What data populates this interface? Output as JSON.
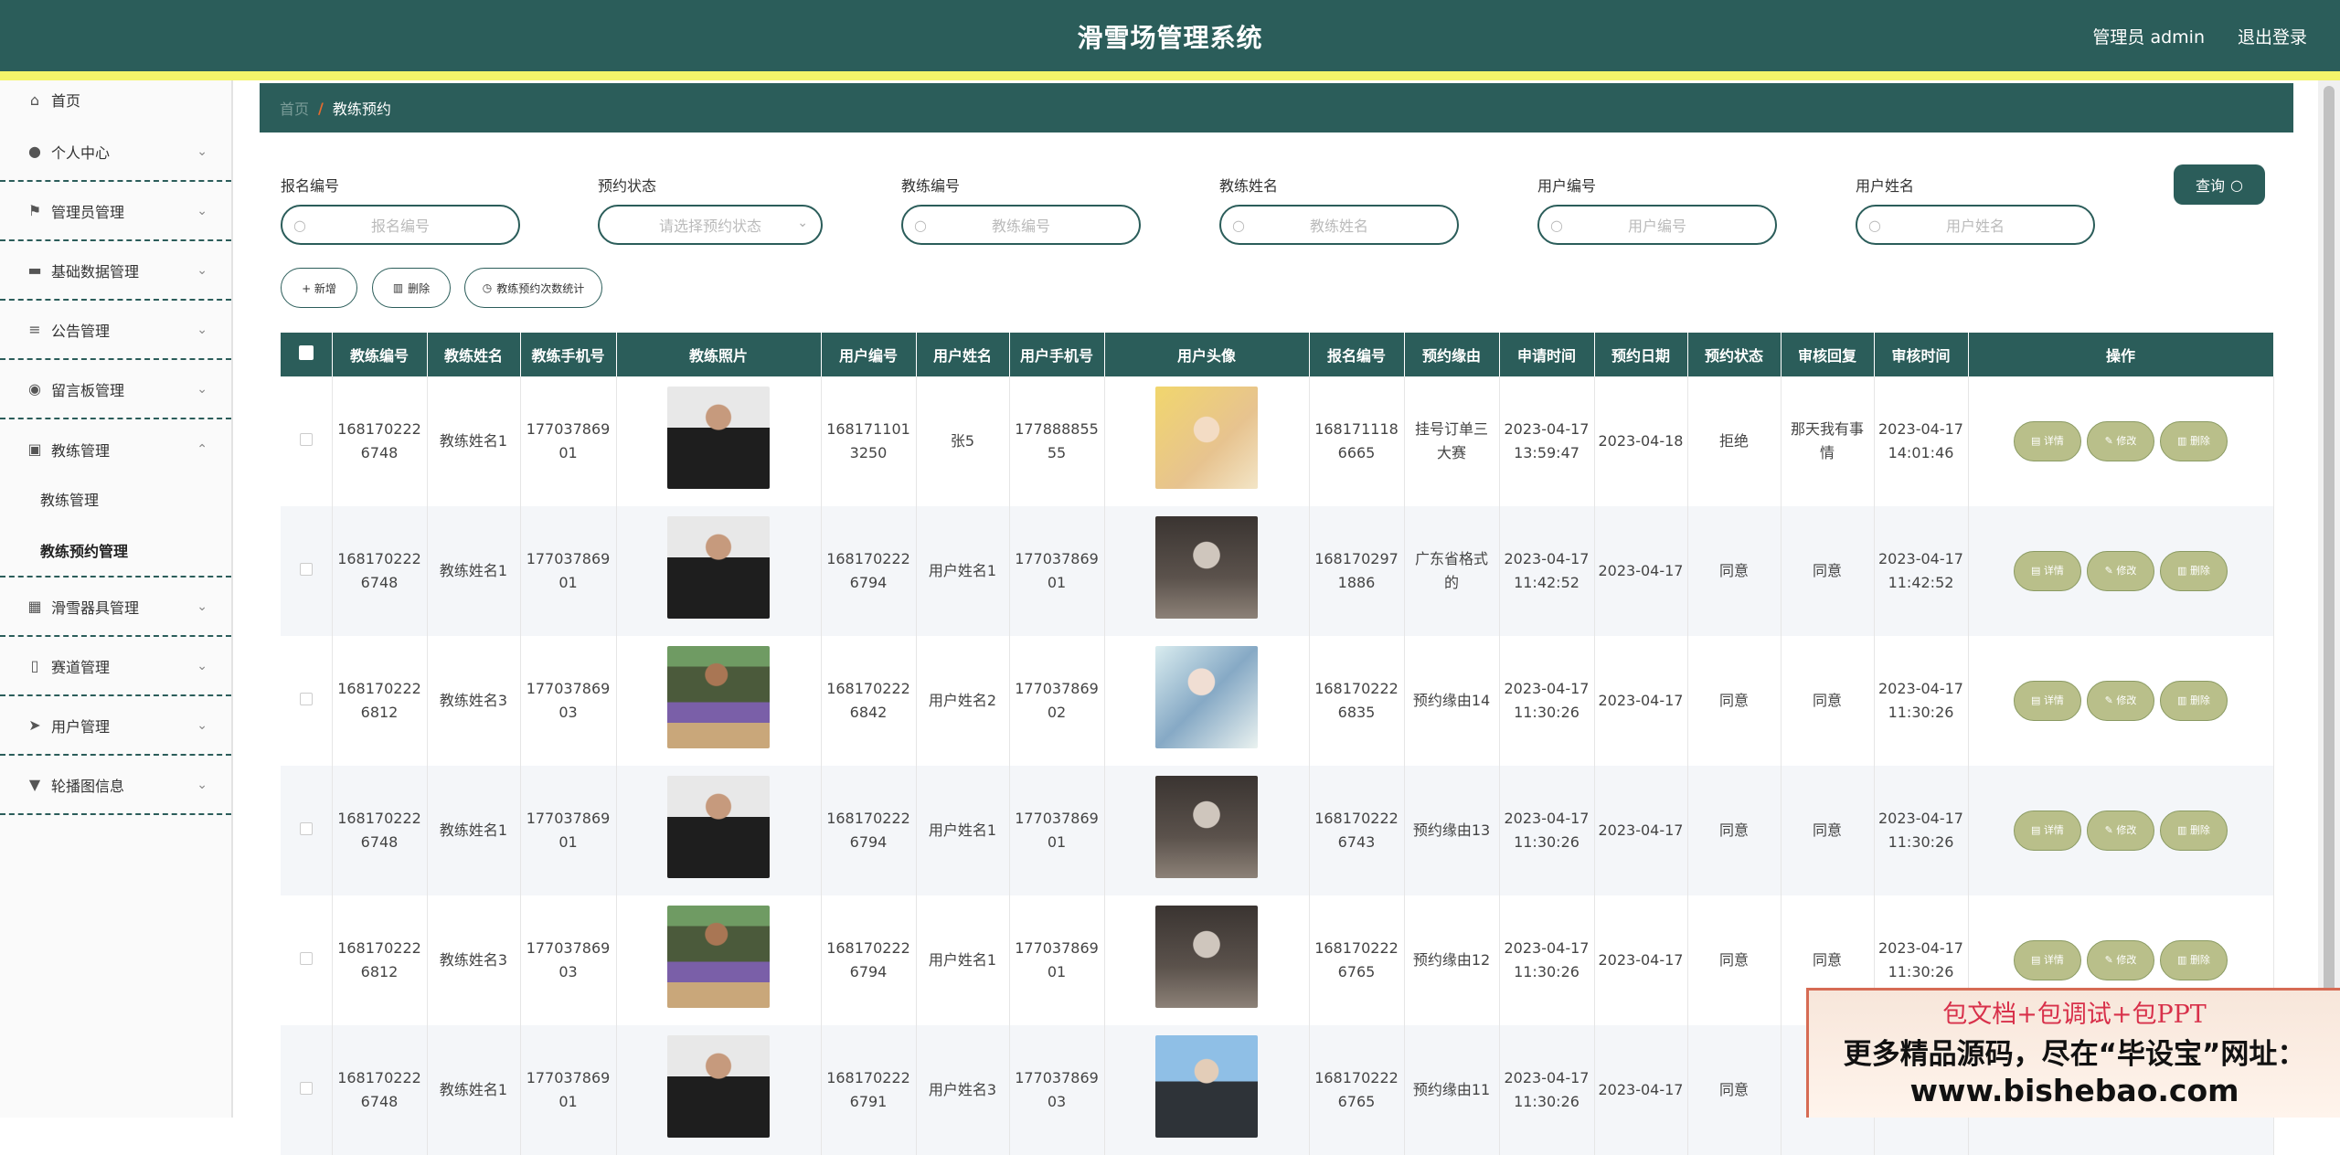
{
  "header": {
    "title": "滑雪场管理系统",
    "user": "管理员 admin",
    "logout": "退出登录"
  },
  "sidebar": {
    "items": [
      {
        "label": "首页",
        "icon": "home-icon"
      },
      {
        "label": "个人中心",
        "icon": "user-icon"
      },
      {
        "label": "管理员管理",
        "icon": "flag-icon"
      },
      {
        "label": "基础数据管理",
        "icon": "monitor-icon"
      },
      {
        "label": "公告管理",
        "icon": "list-icon"
      },
      {
        "label": "留言板管理",
        "icon": "location-icon"
      },
      {
        "label": "教练管理",
        "icon": "briefcase-icon"
      },
      {
        "label": "滑雪器具管理",
        "icon": "grid-icon"
      },
      {
        "label": "赛道管理",
        "icon": "lock-icon"
      },
      {
        "label": "用户管理",
        "icon": "send-icon"
      },
      {
        "label": "轮播图信息",
        "icon": "sign-icon"
      }
    ],
    "sub_items": [
      {
        "label": "教练管理"
      },
      {
        "label": "教练预约管理"
      }
    ]
  },
  "breadcrumb": {
    "home": "首页",
    "separator": "/",
    "current": "教练预约"
  },
  "filters": {
    "fields": [
      {
        "label": "报名编号",
        "placeholder": "报名编号"
      },
      {
        "label": "预约状态",
        "placeholder": "请选择预约状态"
      },
      {
        "label": "教练编号",
        "placeholder": "教练编号"
      },
      {
        "label": "教练姓名",
        "placeholder": "教练姓名"
      },
      {
        "label": "用户编号",
        "placeholder": "用户编号"
      },
      {
        "label": "用户姓名",
        "placeholder": "用户姓名"
      }
    ],
    "query_label": "查询"
  },
  "actions": {
    "add": "+ 新增",
    "delete": "删除",
    "stats": "教练预约次数统计"
  },
  "table": {
    "columns": [
      "教练编号",
      "教练姓名",
      "教练手机号",
      "教练照片",
      "用户编号",
      "用户姓名",
      "用户手机号",
      "用户头像",
      "报名编号",
      "预约缘由",
      "申请时间",
      "预约日期",
      "预约状态",
      "审核回复",
      "审核时间",
      "操作"
    ],
    "buttons": {
      "detail": "详情",
      "edit": "修改",
      "delete": "删除"
    },
    "rows": [
      {
        "coach_no": "1681702226748",
        "coach_name": "教练姓名1",
        "coach_phone": "17703786901",
        "coach_photo": "coach-a",
        "user_no": "1681711013250",
        "user_name": "张5",
        "user_phone": "17788885555",
        "user_avatar": "user-a",
        "reg_no": "1681711186665",
        "reason": "挂号订单三大赛",
        "apply_time": "2023-04-17 13:59:47",
        "date": "2023-04-18",
        "status": "拒绝",
        "reply": "那天我有事情",
        "review_time": "2023-04-17 14:01:46"
      },
      {
        "coach_no": "1681702226748",
        "coach_name": "教练姓名1",
        "coach_phone": "17703786901",
        "coach_photo": "coach-a",
        "user_no": "1681702226794",
        "user_name": "用户姓名1",
        "user_phone": "17703786901",
        "user_avatar": "user-b",
        "reg_no": "1681702971886",
        "reason": "广东省格式的",
        "apply_time": "2023-04-17 11:42:52",
        "date": "2023-04-17",
        "status": "同意",
        "reply": "同意",
        "review_time": "2023-04-17 11:42:52"
      },
      {
        "coach_no": "1681702226812",
        "coach_name": "教练姓名3",
        "coach_phone": "17703786903",
        "coach_photo": "coach-b",
        "user_no": "1681702226842",
        "user_name": "用户姓名2",
        "user_phone": "17703786902",
        "user_avatar": "user-c",
        "reg_no": "1681702226835",
        "reason": "预约缘由14",
        "apply_time": "2023-04-17 11:30:26",
        "date": "2023-04-17",
        "status": "同意",
        "reply": "同意",
        "review_time": "2023-04-17 11:30:26"
      },
      {
        "coach_no": "1681702226748",
        "coach_name": "教练姓名1",
        "coach_phone": "17703786901",
        "coach_photo": "coach-a",
        "user_no": "1681702226794",
        "user_name": "用户姓名1",
        "user_phone": "17703786901",
        "user_avatar": "user-b",
        "reg_no": "1681702226743",
        "reason": "预约缘由13",
        "apply_time": "2023-04-17 11:30:26",
        "date": "2023-04-17",
        "status": "同意",
        "reply": "同意",
        "review_time": "2023-04-17 11:30:26"
      },
      {
        "coach_no": "1681702226812",
        "coach_name": "教练姓名3",
        "coach_phone": "17703786903",
        "coach_photo": "coach-b",
        "user_no": "1681702226794",
        "user_name": "用户姓名1",
        "user_phone": "17703786901",
        "user_avatar": "user-b",
        "reg_no": "1681702226765",
        "reason": "预约缘由12",
        "apply_time": "2023-04-17 11:30:26",
        "date": "2023-04-17",
        "status": "同意",
        "reply": "同意",
        "review_time": "2023-04-17 11:30:26"
      },
      {
        "coach_no": "1681702226748",
        "coach_name": "教练姓名1",
        "coach_phone": "17703786901",
        "coach_photo": "coach-a",
        "user_no": "1681702226791",
        "user_name": "用户姓名3",
        "user_phone": "17703786903",
        "user_avatar": "user-d",
        "reg_no": "1681702226765",
        "reason": "预约缘由11",
        "apply_time": "2023-04-17 11:30:26",
        "date": "2023-04-17",
        "status": "同意",
        "reply": "",
        "review_time": ""
      }
    ]
  },
  "promo": {
    "line1": "包文档+包调试+包PPT",
    "line2": "更多精品源码，尽在“毕设宝”网址：",
    "line3": "www.bishebao.com"
  },
  "colors": {
    "primary": "#2b5d5a",
    "accent_stripe": "#f4f46a",
    "op_button": "#b9bf8a"
  }
}
